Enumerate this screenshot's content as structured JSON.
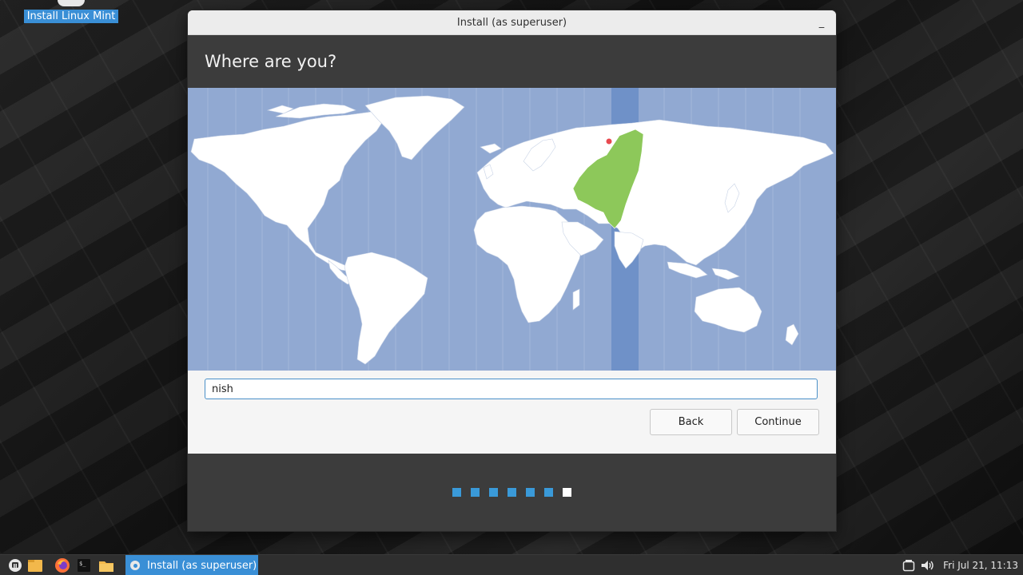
{
  "desktop": {
    "icon_label": "Install Linux Mint"
  },
  "window": {
    "title": "Install (as superuser)",
    "minimize_glyph": "_",
    "header": "Where are you?",
    "search": {
      "value": "nish",
      "placeholder": ""
    },
    "back_label": "Back",
    "continue_label": "Continue",
    "progress": {
      "total_steps": 7,
      "current_step": 7
    }
  },
  "colors": {
    "ocean": "#91a9d2",
    "land": "#ffffff",
    "selected_region": "#8dc85a",
    "timezone_band": "#6f91c8",
    "accent": "#3a9ad9"
  },
  "taskbar": {
    "launchers": [
      "menu-icon",
      "files-icon",
      "firefox-icon",
      "terminal-icon",
      "folder-icon"
    ],
    "active_task_label": "Install (as superuser)",
    "tray_icons": [
      "window-list-icon",
      "volume-icon"
    ],
    "clock": "Fri Jul 21, 11:13"
  }
}
